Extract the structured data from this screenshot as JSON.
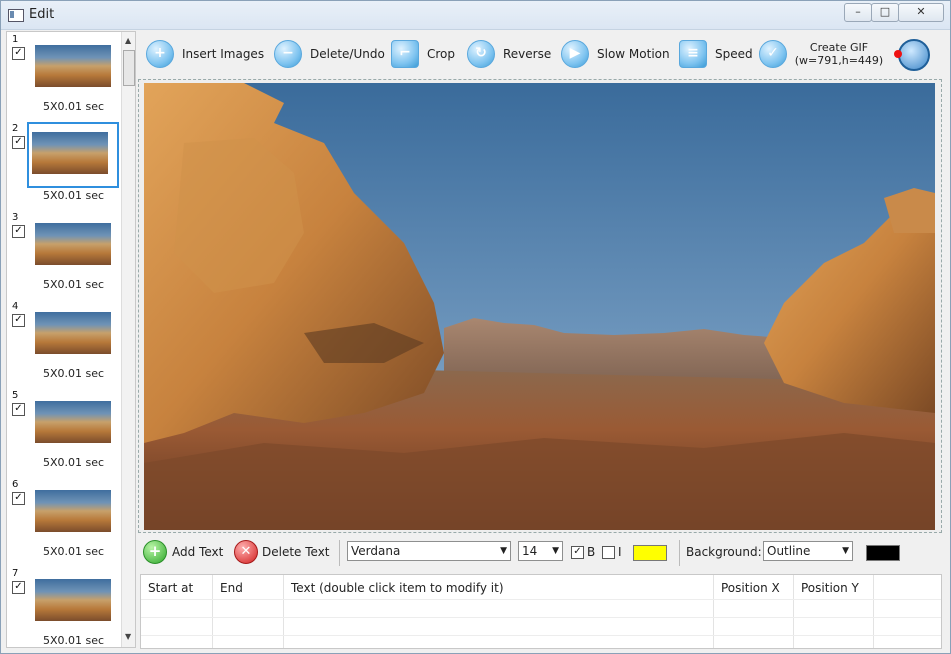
{
  "window": {
    "title": "Edit",
    "controls": {
      "minimize": "–",
      "maximize": "□",
      "close": "✕"
    }
  },
  "frames": [
    {
      "number": "1",
      "caption": "5X0.01 sec",
      "checked": true,
      "selected": false
    },
    {
      "number": "2",
      "caption": "5X0.01 sec",
      "checked": true,
      "selected": true
    },
    {
      "number": "3",
      "caption": "5X0.01 sec",
      "checked": true,
      "selected": false
    },
    {
      "number": "4",
      "caption": "5X0.01 sec",
      "checked": true,
      "selected": false
    },
    {
      "number": "5",
      "caption": "5X0.01 sec",
      "checked": true,
      "selected": false
    },
    {
      "number": "6",
      "caption": "5X0.01 sec",
      "checked": true,
      "selected": false
    },
    {
      "number": "7",
      "caption": "5X0.01 sec",
      "checked": true,
      "selected": false
    }
  ],
  "toolbar": {
    "insert_images": "Insert Images",
    "delete_undo": "Delete/Undo",
    "crop": "Crop",
    "reverse": "Reverse",
    "slow_motion": "Slow Motion",
    "speed": "Speed",
    "create_gif": "Create GIF",
    "create_gif_size": "(w=791,h=449)"
  },
  "text_tools": {
    "add_text": "Add Text",
    "delete_text": "Delete Text",
    "font": "Verdana",
    "size": "14",
    "bold_label": "B",
    "bold_checked": true,
    "italic_label": "I",
    "italic_checked": false,
    "text_color": "#ffff00",
    "background_label": "Background:",
    "background_mode": "Outline",
    "background_color": "#000000"
  },
  "grid": {
    "columns": [
      "Start at",
      "End",
      "Text (double click item to modify it)",
      "Position X",
      "Position Y"
    ],
    "rows": []
  },
  "icons": {
    "insert_images": "plus-circle-icon",
    "delete_undo": "minus-circle-icon",
    "crop": "crop-icon",
    "reverse": "reverse-icon",
    "slow_motion": "play-icon",
    "speed": "speed-sliders-icon",
    "create_gif": "checkmark-icon",
    "record": "record-icon"
  }
}
